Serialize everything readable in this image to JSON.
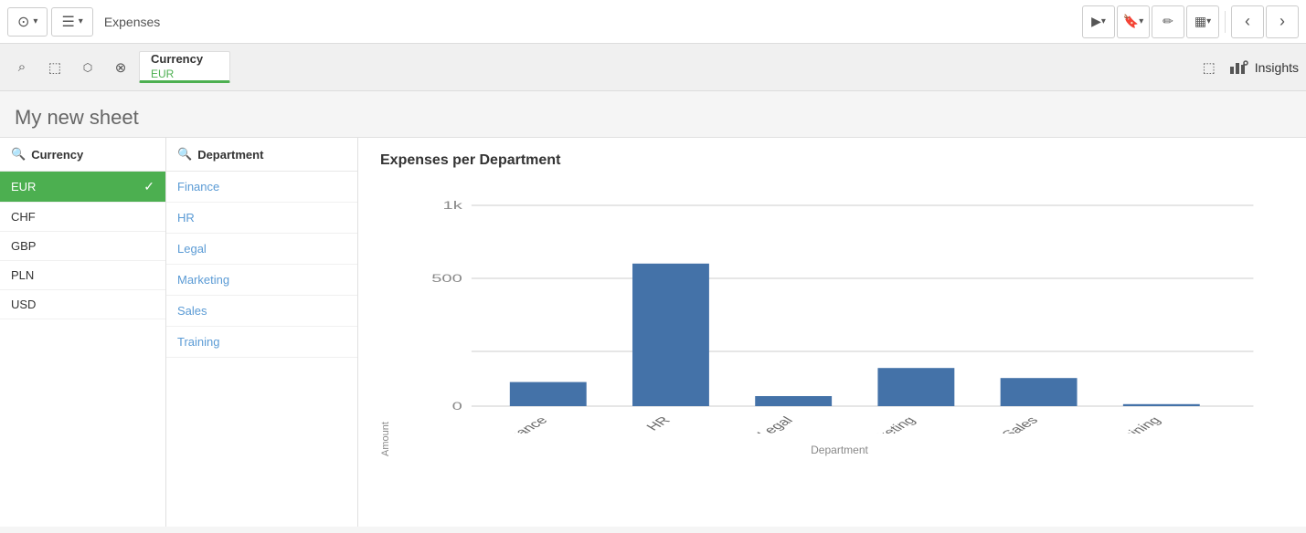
{
  "app": {
    "icon": "⊙",
    "name": "Expenses"
  },
  "toolbar": {
    "left_btns": [
      {
        "id": "compass",
        "icon": "⊙",
        "has_dropdown": true
      },
      {
        "id": "list",
        "icon": "☰",
        "has_dropdown": true
      }
    ],
    "right_btns": [
      {
        "id": "present",
        "icon": "▶",
        "has_dropdown": true
      },
      {
        "id": "bookmark",
        "icon": "🔖",
        "has_dropdown": true
      },
      {
        "id": "edit",
        "icon": "✏"
      },
      {
        "id": "chart",
        "icon": "▦",
        "has_dropdown": true
      },
      {
        "id": "back",
        "icon": "‹"
      },
      {
        "id": "forward",
        "icon": "›"
      }
    ]
  },
  "filter_bar": {
    "tools": [
      {
        "id": "search",
        "icon": "⌕"
      },
      {
        "id": "select",
        "icon": "⬚"
      },
      {
        "id": "lasso",
        "icon": "⬡"
      },
      {
        "id": "clear",
        "icon": "⊗"
      }
    ],
    "active_filter": {
      "label": "Currency",
      "value": "EUR"
    },
    "right": {
      "select_region_icon": "⬚",
      "insights_icon": "📊",
      "insights_label": "Insights"
    }
  },
  "sheet": {
    "title": "My new sheet"
  },
  "currency_panel": {
    "header": "Currency",
    "search_icon": "🔍",
    "items": [
      {
        "id": "EUR",
        "label": "EUR",
        "active": true
      },
      {
        "id": "CHF",
        "label": "CHF",
        "active": false
      },
      {
        "id": "GBP",
        "label": "GBP",
        "active": false
      },
      {
        "id": "PLN",
        "label": "PLN",
        "active": false
      },
      {
        "id": "USD",
        "label": "USD",
        "active": false
      }
    ]
  },
  "department_panel": {
    "header": "Department",
    "search_icon": "🔍",
    "items": [
      {
        "id": "Finance",
        "label": "Finance"
      },
      {
        "id": "HR",
        "label": "HR"
      },
      {
        "id": "Legal",
        "label": "Legal"
      },
      {
        "id": "Marketing",
        "label": "Marketing"
      },
      {
        "id": "Sales",
        "label": "Sales"
      },
      {
        "id": "Training",
        "label": "Training"
      }
    ]
  },
  "chart": {
    "title": "Expenses per Department",
    "y_label": "Amount",
    "x_label": "Department",
    "y_ticks": [
      "1k",
      "500",
      "0"
    ],
    "bars": [
      {
        "label": "Finance",
        "value": 120,
        "max": 1000
      },
      {
        "label": "HR",
        "value": 710,
        "max": 1000
      },
      {
        "label": "Legal",
        "value": 50,
        "max": 1000
      },
      {
        "label": "Marketing",
        "value": 190,
        "max": 1000
      },
      {
        "label": "Sales",
        "value": 140,
        "max": 1000
      },
      {
        "label": "Training",
        "value": 10,
        "max": 1000
      }
    ],
    "bar_color": "#4472a8"
  }
}
